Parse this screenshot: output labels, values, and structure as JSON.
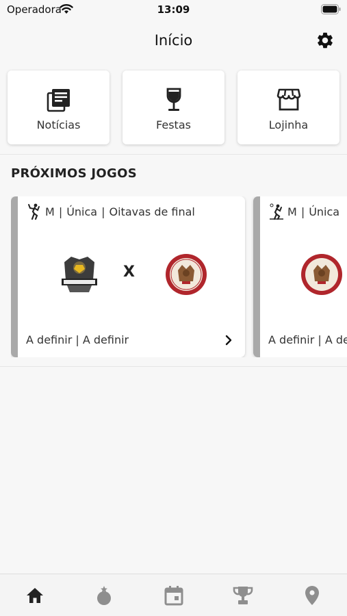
{
  "status_bar": {
    "carrier": "Operadora",
    "time": "13:09"
  },
  "header": {
    "title": "Início",
    "settings_icon": "gear-icon"
  },
  "quick_actions": [
    {
      "label": "Notícias",
      "icon": "news-icon"
    },
    {
      "label": "Festas",
      "icon": "wine-glass-icon"
    },
    {
      "label": "Lojinha",
      "icon": "store-icon"
    }
  ],
  "upcoming": {
    "title": "PRÓXIMOS JOGOS",
    "games": [
      {
        "sport_icon": "volleyball-player-icon",
        "gender": "M",
        "phase": "Única",
        "round": "Oitavas de final",
        "vs": "X",
        "footer": "A definir | A definir"
      },
      {
        "sport_icon": "beach-volleyball-icon",
        "gender": "M",
        "phase": "Única",
        "round": "",
        "vs": "",
        "footer": "A definir | A definir"
      }
    ]
  },
  "tab_bar": {
    "items": [
      {
        "name": "home",
        "icon": "home-icon",
        "active": true
      },
      {
        "name": "medal",
        "icon": "medal-icon",
        "active": false
      },
      {
        "name": "calendar",
        "icon": "calendar-icon",
        "active": false
      },
      {
        "name": "trophy",
        "icon": "trophy-icon",
        "active": false
      },
      {
        "name": "location",
        "icon": "location-icon",
        "active": false
      }
    ]
  },
  "colors": {
    "accent_bar": "#a9a9a9",
    "active_tab": "#222222",
    "inactive_tab": "#8e8e8e",
    "badge_red": "#b0262c"
  }
}
